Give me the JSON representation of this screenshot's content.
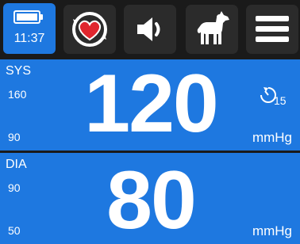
{
  "status": {
    "time": "11:37",
    "battery_level": 1.0
  },
  "toolbar": {
    "buttons": [
      {
        "name": "heart-cycle",
        "icon": "heart-cycle-icon"
      },
      {
        "name": "sound",
        "icon": "speaker-icon"
      },
      {
        "name": "patient-dog",
        "icon": "dog-icon"
      },
      {
        "name": "menu",
        "icon": "menu-icon"
      }
    ]
  },
  "sys": {
    "label": "SYS",
    "limit_high": "160",
    "limit_low": "90",
    "value": "120",
    "unit": "mmHg",
    "interval": "15"
  },
  "dia": {
    "label": "DIA",
    "limit_high": "90",
    "limit_low": "50",
    "value": "80",
    "unit": "mmHg"
  },
  "colors": {
    "panel": "#1e78e0",
    "background": "#1a1a1a",
    "button": "#2b2b2b",
    "heart": "#e0262e"
  }
}
